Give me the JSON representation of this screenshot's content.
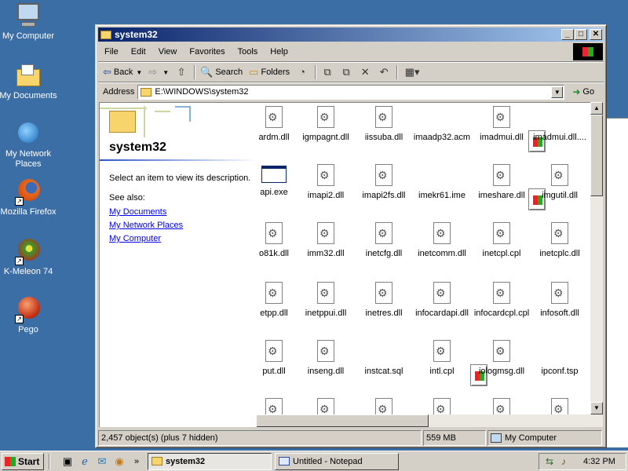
{
  "desktop": {
    "icons": [
      {
        "label": "My Computer",
        "icon": "my-computer-icon"
      },
      {
        "label": "My Documents",
        "icon": "my-documents-icon"
      },
      {
        "label": "My Network Places",
        "icon": "network-places-icon"
      },
      {
        "label": "Mozilla Firefox",
        "icon": "firefox-icon"
      },
      {
        "label": "K-Meleon 74",
        "icon": "k-meleon-icon"
      },
      {
        "label": "Pego",
        "icon": "pego-icon"
      }
    ]
  },
  "window": {
    "title": "system32",
    "menu": [
      "File",
      "Edit",
      "View",
      "Favorites",
      "Tools",
      "Help"
    ],
    "toolbar": {
      "back": "Back",
      "search": "Search",
      "folders": "Folders"
    },
    "address": {
      "label": "Address",
      "value": "E:\\WINDOWS\\system32",
      "go": "Go"
    },
    "webview": {
      "title": "system32",
      "description": "Select an item to view its description.",
      "see_also": "See also:",
      "links": [
        "My Documents",
        "My Network Places",
        "My Computer"
      ]
    },
    "files": [
      [
        "ardm.dll",
        "igmpagnt.dll",
        "iissuba.dll",
        "imaadp32.acm",
        "imadmui.dll",
        "imadmui.dll...."
      ],
      [
        "api.exe",
        "imapi2.dll",
        "imapi2fs.dll",
        "imekr61.ime",
        "imeshare.dll",
        "imgutil.dll"
      ],
      [
        "o81k.dll",
        "imm32.dll",
        "inetcfg.dll",
        "inetcomm.dll",
        "inetcpl.cpl",
        "inetcplc.dll"
      ],
      [
        "etpp.dll",
        "inetppui.dll",
        "inetres.dll",
        "infocardapi.dll",
        "infocardcpl.cpl",
        "infosoft.dll"
      ],
      [
        "put.dll",
        "inseng.dll",
        "instcat.sql",
        "intl.cpl",
        "iologmsg.dll",
        "ipconf.tsp"
      ]
    ],
    "status": {
      "objects": "2,457 object(s) (plus 7 hidden)",
      "size": "559 MB",
      "location": "My Computer"
    }
  },
  "taskbar": {
    "start": "Start",
    "tasks": [
      "system32",
      "Untitled - Notepad"
    ],
    "clock": "4:32 PM"
  }
}
